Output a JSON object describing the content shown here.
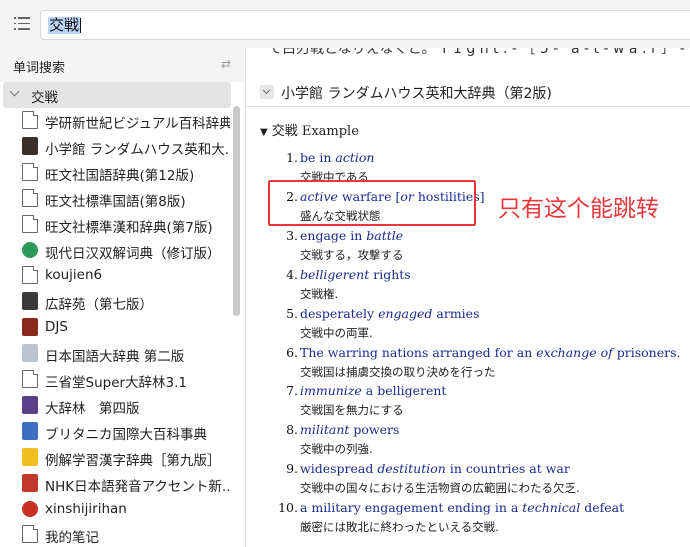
{
  "search": {
    "query": "交戦"
  },
  "sidebar": {
    "title": "单词搜索",
    "group_label": "交戦",
    "items": [
      {
        "label": "学研新世紀ビジュアル百科辞典",
        "icon": "document-icon"
      },
      {
        "label": "小学館 ランダムハウス英和大...",
        "icon": "book-cover-icon",
        "color": "#3b2f2a"
      },
      {
        "label": "旺文社国語辞典(第12版)",
        "icon": "document-icon"
      },
      {
        "label": "旺文社標準国語(第8版)",
        "icon": "document-icon"
      },
      {
        "label": "旺文社標準漢和辞典(第7版)",
        "icon": "document-icon"
      },
      {
        "label": "现代日汉双解词典（修订版）",
        "icon": "green-circle-icon",
        "color": "#2d9a5b"
      },
      {
        "label": "koujien6",
        "icon": "document-icon"
      },
      {
        "label": "広辞苑（第七版）",
        "icon": "book-cover-icon",
        "color": "#3a3a3a"
      },
      {
        "label": "DJS",
        "icon": "book-cover-icon",
        "color": "#8a2a1e"
      },
      {
        "label": "日本国語大辞典 第二版",
        "icon": "book-cover-icon",
        "color": "#b9c4cf"
      },
      {
        "label": "三省堂Super大辞林3.1",
        "icon": "document-icon"
      },
      {
        "label": "大辞林　第四版",
        "icon": "book-cover-icon",
        "color": "#5a3f8a"
      },
      {
        "label": "ブリタニカ国際大百科事典",
        "icon": "britannica-icon",
        "color": "#3f6fc0"
      },
      {
        "label": "例解学習漢字辞典［第九版］",
        "icon": "book-cover-icon",
        "color": "#f0c020"
      },
      {
        "label": "NHK日本語発音アクセント新...",
        "icon": "book-cover-icon",
        "color": "#c0392b"
      },
      {
        "label": "xinshijirihan",
        "icon": "red-circle-icon",
        "color": "#c83224"
      },
      {
        "label": "我的笔记",
        "icon": "document-icon"
      }
    ]
  },
  "content": {
    "clipped_line": "て白刃戦となりえなくと。 Y 1 g h t . -  ［ 5 - ' a - t - w a : r ］ -",
    "dictionary_title": "小学館 ランダムハウス英和大辞典（第2版)",
    "entry_head": "交戦 Example",
    "examples": [
      {
        "num": "1.",
        "en_html": "be in <i>action</i>",
        "jp": "交戦中である"
      },
      {
        "num": "2.",
        "en_html": "<i>active</i> warfare [<i>or</i> hostilities]",
        "jp": "盛んな交戦状態"
      },
      {
        "num": "3.",
        "en_html": "engage in <i>battle</i>",
        "jp": "交戦する，攻撃する"
      },
      {
        "num": "4.",
        "en_html": "<i>belligerent</i> rights",
        "jp": "交戦権."
      },
      {
        "num": "5.",
        "en_html": "desperately <i>engaged</i> armies",
        "jp": "交戦中の両軍."
      },
      {
        "num": "6.",
        "en_html": "The warring nations arranged for an <i>exchange of</i> prisoners.",
        "jp": "交戦国は捕虜交換の取り決めを行った"
      },
      {
        "num": "7.",
        "en_html": "<i>immunize</i> a belligerent",
        "jp": "交戦国を無力にする"
      },
      {
        "num": "8.",
        "en_html": "<i>militant</i> powers",
        "jp": "交戦中の列強."
      },
      {
        "num": "9.",
        "en_html": "widespread <i>destitution</i> in countries at war",
        "jp": "交戦中の国々における生活物資の広範囲にわたる欠乏."
      },
      {
        "num": "10.",
        "en_html": "a military engagement ending in a <i>technical</i> defeat",
        "jp": "厳密には敗北に終わったといえる交戦."
      }
    ],
    "annotation": "只有这个能跳转",
    "accent_red": "#e8383d",
    "link_blue": "#1a2b8c"
  }
}
